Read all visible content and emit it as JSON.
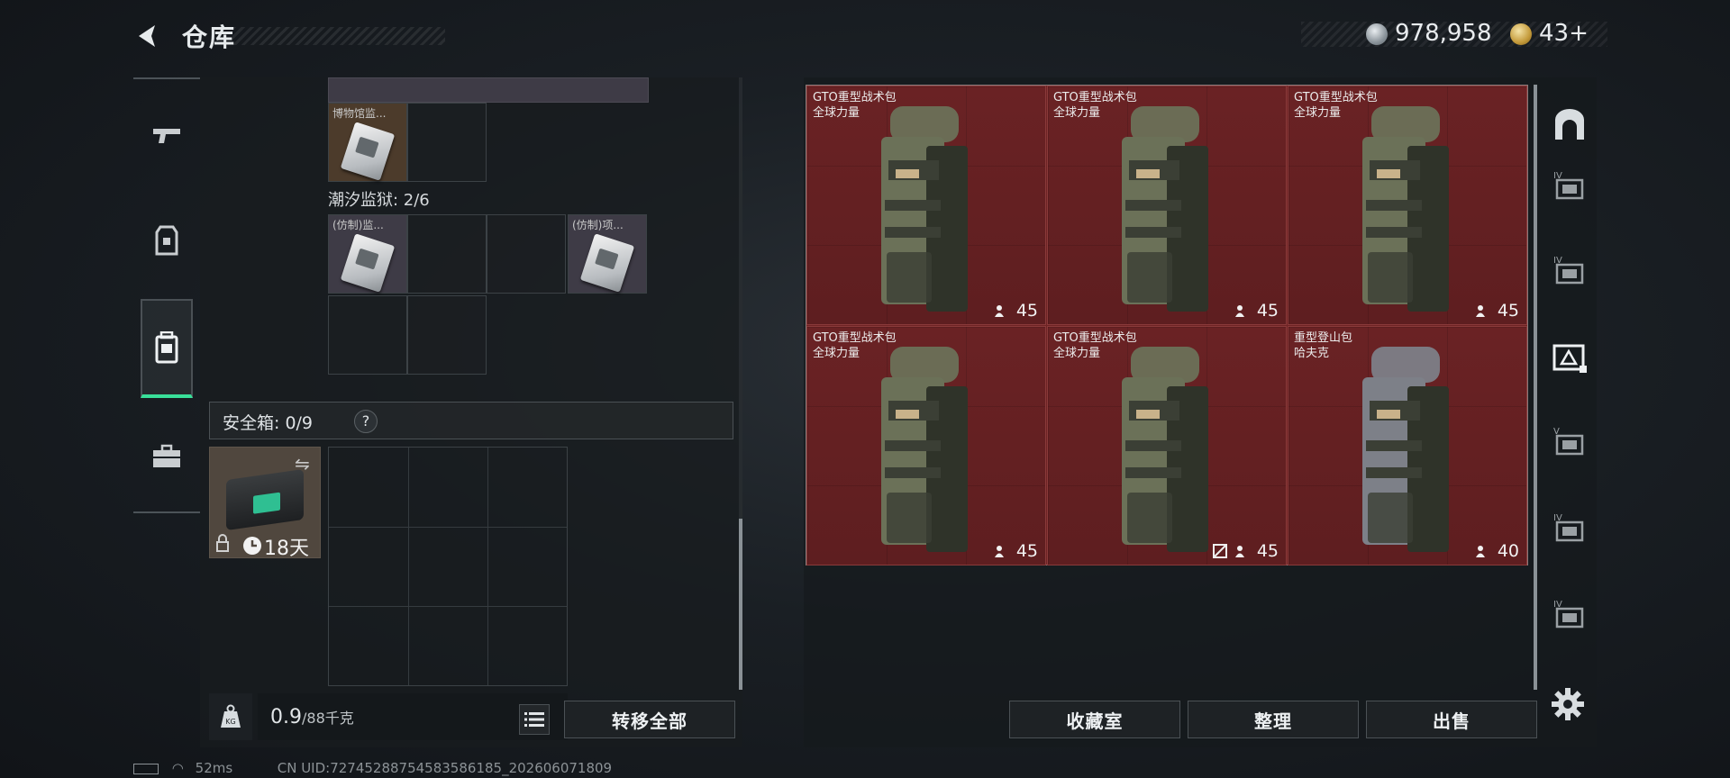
{
  "header": {
    "title": "仓库",
    "silver_amount": "978,958",
    "gold_amount": "43+"
  },
  "left_panel": {
    "top_item_label": "博物馆监...",
    "tidal_prison_label": "潮汐监狱: 2/6",
    "tidal_items": [
      {
        "label": "(仿制)监..."
      },
      {
        "label": "(仿制)项..."
      }
    ],
    "safe_box_label": "安全箱: 0/9",
    "help_label": "?",
    "case_days": "18天",
    "weight_current": "0.9",
    "weight_max": "/88千克",
    "transfer_all": "转移全部"
  },
  "right_panel": {
    "packs": [
      {
        "name1": "GTO重型战术包",
        "name2": "全球力量",
        "value": "45",
        "locked_icon": false,
        "color": "#6b7158"
      },
      {
        "name1": "GTO重型战术包",
        "name2": "全球力量",
        "value": "45",
        "locked_icon": false,
        "color": "#6b7158"
      },
      {
        "name1": "GTO重型战术包",
        "name2": "全球力量",
        "value": "45",
        "locked_icon": false,
        "color": "#6b7158"
      },
      {
        "name1": "GTO重型战术包",
        "name2": "全球力量",
        "value": "45",
        "locked_icon": false,
        "color": "#6b7158"
      },
      {
        "name1": "GTO重型战术包",
        "name2": "全球力量",
        "value": "45",
        "locked_icon": true,
        "color": "#6b7158"
      },
      {
        "name1": "重型登山包",
        "name2": "哈夫克",
        "value": "40",
        "locked_icon": false,
        "color": "#7d8088"
      }
    ],
    "buttons": {
      "collection": "收藏室",
      "organize": "整理",
      "sell": "出售"
    },
    "tier_labels": [
      "IV",
      "IV",
      "V",
      "IV",
      "IV"
    ]
  },
  "status": {
    "ping": "52ms",
    "uid": "CN UID:7274528875458358618​5_202606071809"
  },
  "colors": {
    "accent_green": "#39e09a",
    "pack_bg": "#6e2324"
  }
}
